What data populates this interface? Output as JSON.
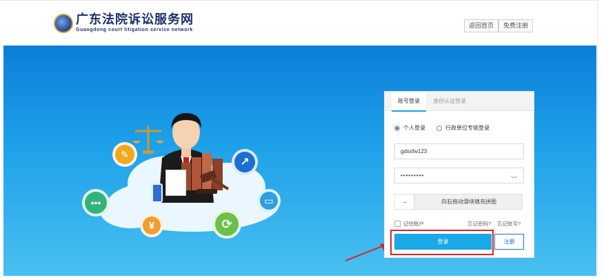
{
  "header": {
    "logo_title": "广东法院诉讼服务网",
    "logo_subtitle": "Guangdong court litigation service network",
    "home_button": "返回首页",
    "register_button": "免费注册"
  },
  "login": {
    "tabs": [
      "账号登录",
      "身份认证登录"
    ],
    "active_tab": "账号登录",
    "radio_options": [
      "个人登录",
      "行政单位专链登录"
    ],
    "selected_radio": "个人登录",
    "username_value": "gdssfw123",
    "password_value": "•••••••••",
    "slider_handle": "→",
    "slider_text": "向右拖动滑块填充拼图",
    "remember_label": "记住账户",
    "forgot_password": "忘记密码?",
    "forgot_account": "忘记账号?",
    "login_button": "登录",
    "register_button": "注册"
  },
  "banner": {
    "icons": [
      "scales-icon",
      "document-icon",
      "arrow-up-right-icon",
      "chat-icon",
      "monitor-icon",
      "yuan-icon",
      "refresh-icon",
      "gavel-icon",
      "phone-icon",
      "books-icon"
    ]
  },
  "colors": {
    "brand_navy": "#1d2d6b",
    "banner_blue": "#1fa2e9",
    "login_button": "#1aa8e6",
    "highlight_red": "#d9232b"
  }
}
